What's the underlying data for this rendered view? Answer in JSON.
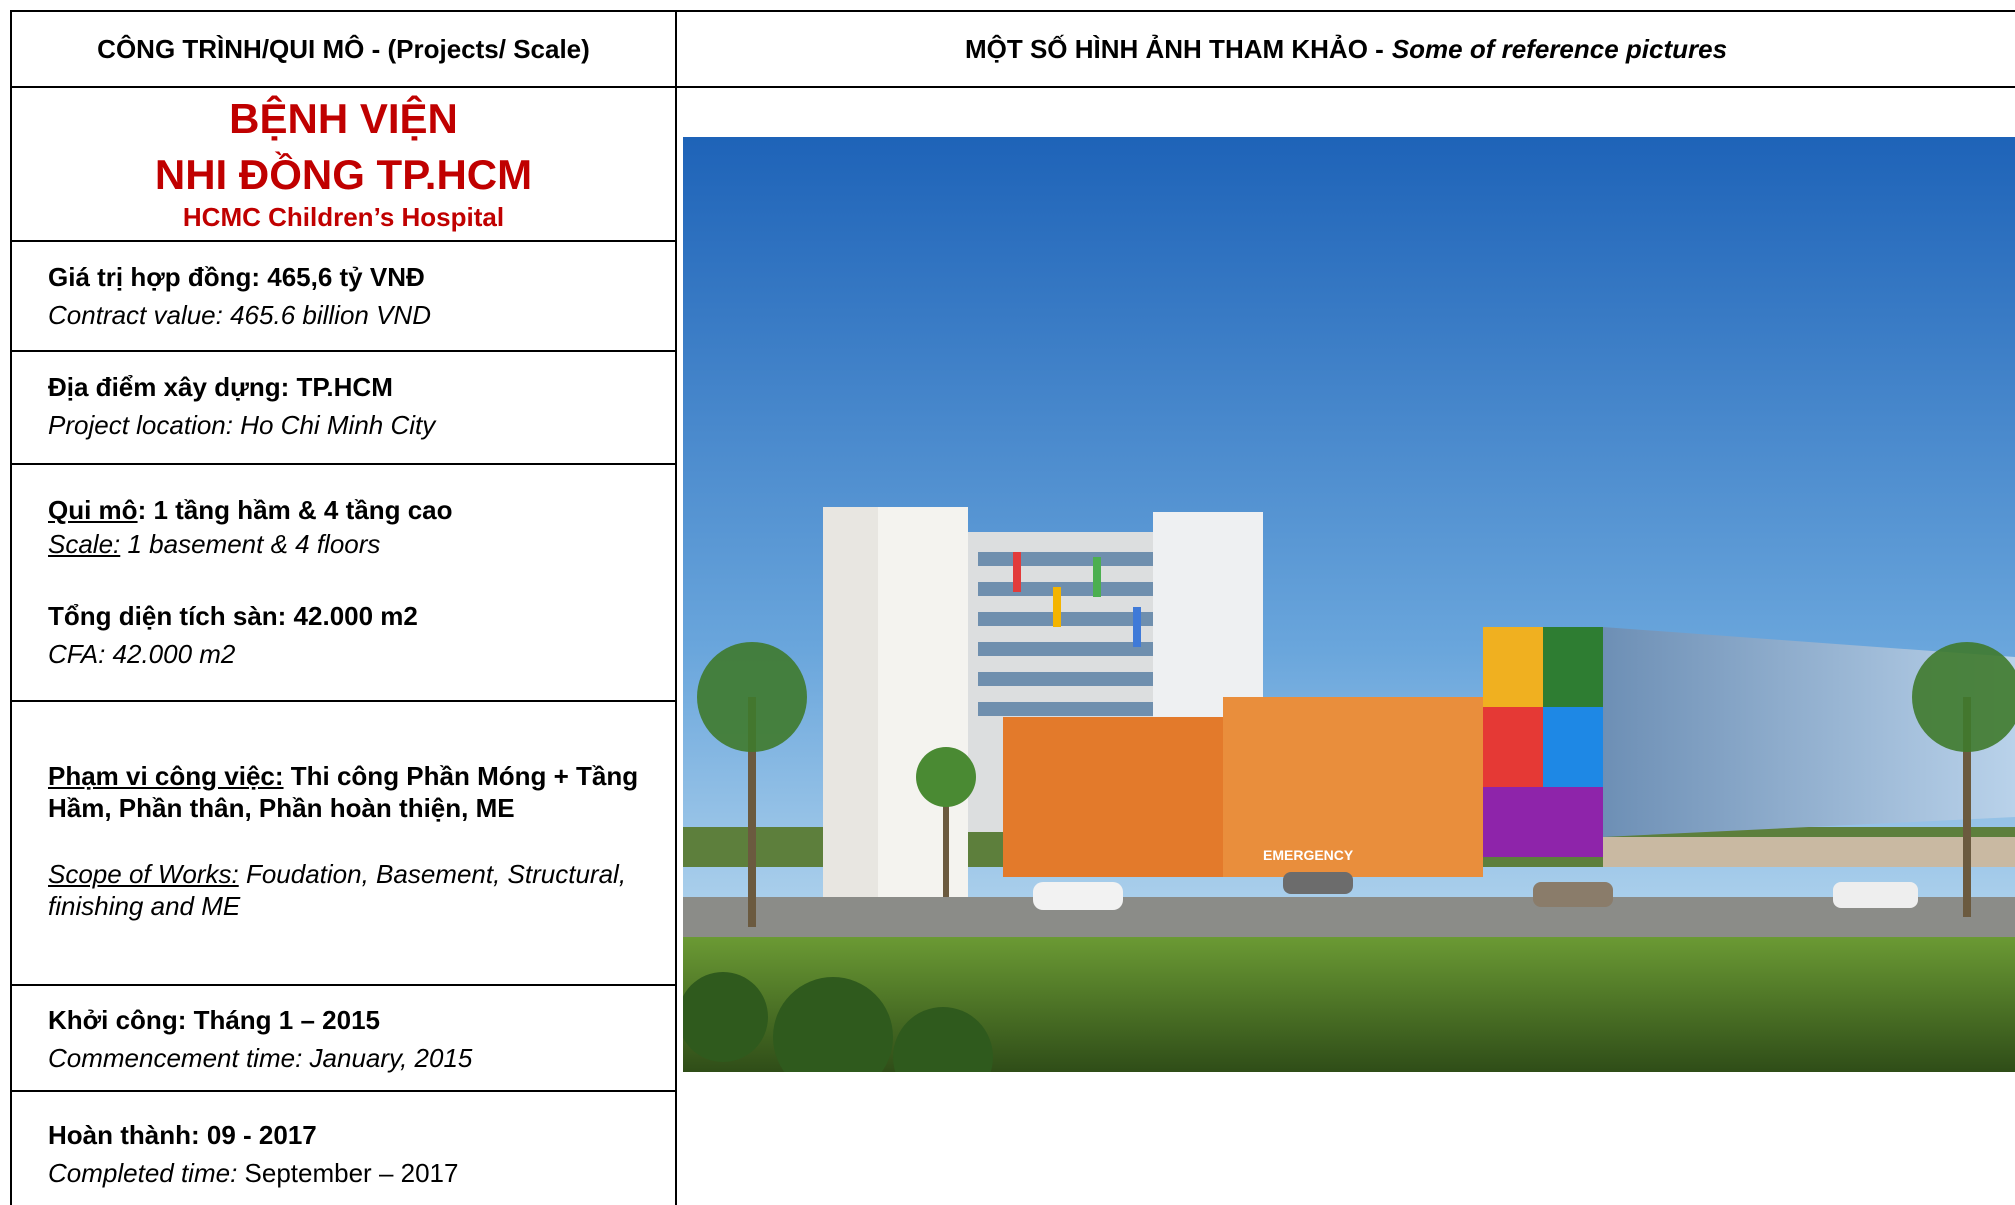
{
  "header": {
    "left": "CÔNG TRÌNH/QUI MÔ - (Projects/ Scale)",
    "right_main": "MỘT SỐ HÌNH ẢNH THAM KHẢO -",
    "right_sub": "Some of reference pictures"
  },
  "project": {
    "title_line1": "BỆNH VIỆN",
    "title_line2": "NHI ĐỒNG TP.HCM",
    "title_en": "HCMC Children’s Hospital"
  },
  "contract": {
    "vi": "Giá trị hợp đồng: 465,6 tỷ VNĐ",
    "en": "Contract value: 465.6 billion VND"
  },
  "location": {
    "vi": "Địa điểm xây dựng:  TP.HCM",
    "en": "Project location: Ho Chi Minh City"
  },
  "scale": {
    "vi_label": "Qui mô",
    "vi_value": ": 1 tầng hầm & 4 tầng cao",
    "en_label": "Scale:",
    "en_value": " 1 basement & 4 floors"
  },
  "cfa": {
    "vi": "Tổng diện tích sàn: 42.000 m2",
    "en": "CFA: 42.000 m2"
  },
  "scope": {
    "vi_label": "Phạm vi công việc:",
    "vi_value": " Thi công Phần Móng + Tầng Hầm, Phần thân, Phần hoàn thiện, ME",
    "en_label": "Scope of Works:",
    "en_value": " Foudation, Basement, Structural, finishing and ME"
  },
  "start": {
    "vi": "Khởi công: Tháng 1 – 2015",
    "en": "Commencement time: January, 2015"
  },
  "complete": {
    "vi": "Hoàn thành: 09 - 2017",
    "en_label": "Completed time:",
    "en_value": " September – 2017"
  },
  "photo": {
    "sign_text": "EMERGENCY"
  },
  "colors": {
    "title_red": "#c00000",
    "sky_top": "#1e63b8",
    "sky_bottom": "#cfe6f5",
    "grass": "#4f7a2a"
  }
}
